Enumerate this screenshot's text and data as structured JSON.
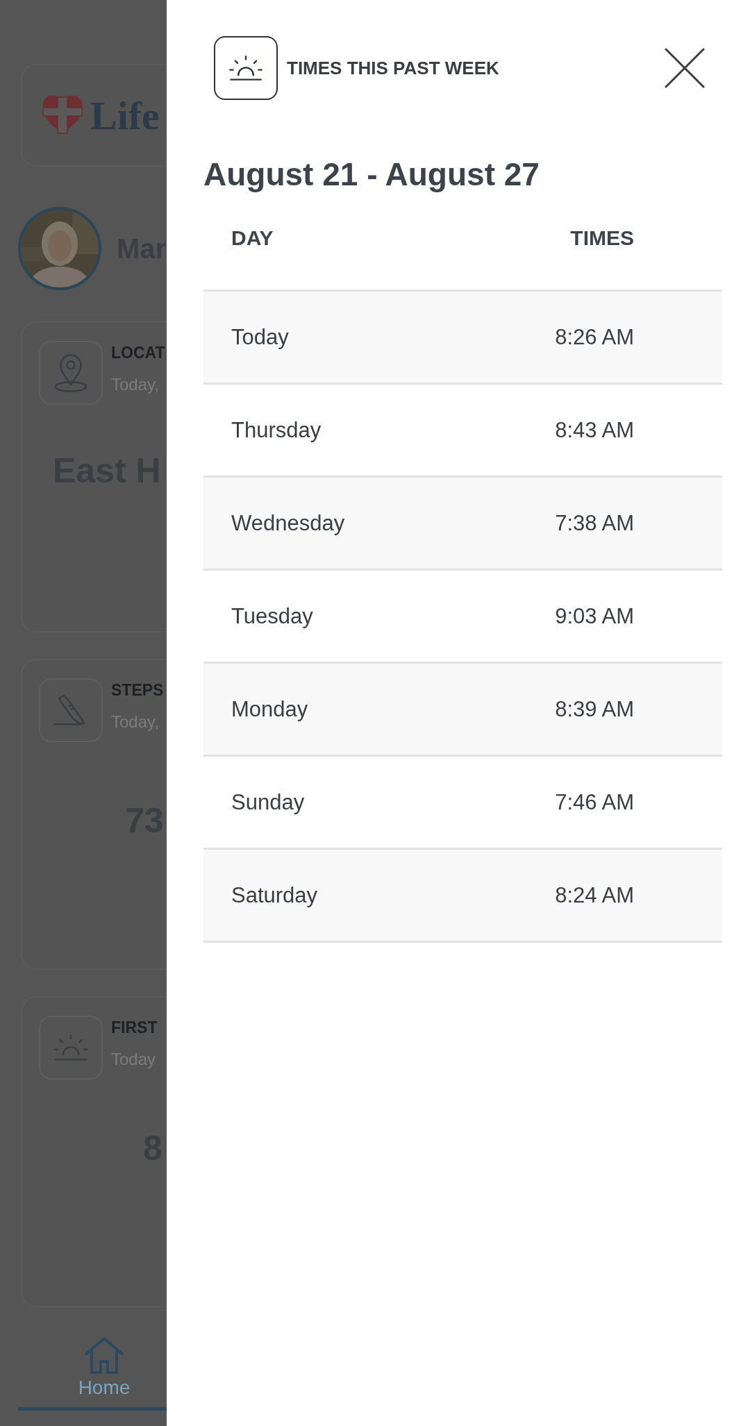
{
  "background": {
    "logo": {
      "text": "Life"
    },
    "profile": {
      "name": "Mar"
    },
    "cards": [
      {
        "kind": "location",
        "title": "LOCAT",
        "subtitle": "Today,",
        "value": "East H"
      },
      {
        "kind": "steps",
        "title": "STEPS",
        "subtitle": "Today,",
        "value": "73"
      },
      {
        "kind": "sunrise",
        "title": "FIRST",
        "subtitle": "Today",
        "value": "8"
      }
    ],
    "nav": [
      {
        "label": "Home",
        "selected": true
      }
    ]
  },
  "panel": {
    "title": "TIMES THIS PAST WEEK",
    "heading": "August 21 - August 27",
    "columns": [
      "DAY",
      "TIMES"
    ],
    "rows": [
      {
        "day": "Today",
        "time": "8:26 AM"
      },
      {
        "day": "Thursday",
        "time": "8:43 AM"
      },
      {
        "day": "Wednesday",
        "time": "7:38 AM"
      },
      {
        "day": "Tuesday",
        "time": "9:03 AM"
      },
      {
        "day": "Monday",
        "time": "8:39 AM"
      },
      {
        "day": "Sunday",
        "time": "7:46 AM"
      },
      {
        "day": "Saturday",
        "time": "8:24 AM"
      }
    ]
  }
}
